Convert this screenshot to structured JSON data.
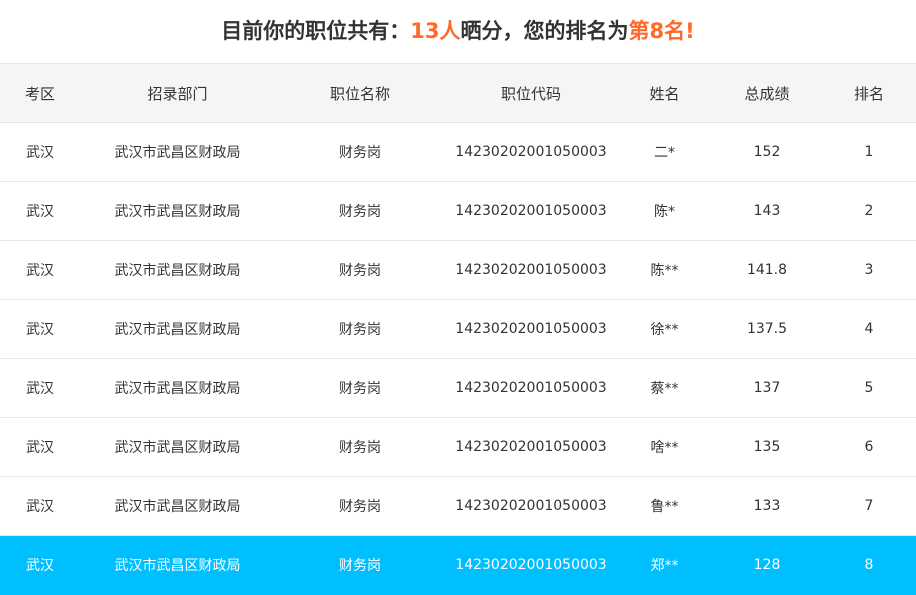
{
  "headline": {
    "prefix": "目前你的职位共有：",
    "count": "13人",
    "middle": "晒分，您的排名为",
    "rank": "第8名",
    "suffix": "!"
  },
  "table": {
    "headers": [
      "考区",
      "招录部门",
      "职位名称",
      "职位代码",
      "姓名",
      "总成绩",
      "排名"
    ],
    "rows": [
      [
        "武汉",
        "武汉市武昌区财政局",
        "财务岗",
        "14230202001050003",
        "二*",
        "152",
        "1"
      ],
      [
        "武汉",
        "武汉市武昌区财政局",
        "财务岗",
        "14230202001050003",
        "陈*",
        "143",
        "2"
      ],
      [
        "武汉",
        "武汉市武昌区财政局",
        "财务岗",
        "14230202001050003",
        "陈**",
        "141.8",
        "3"
      ],
      [
        "武汉",
        "武汉市武昌区财政局",
        "财务岗",
        "14230202001050003",
        "徐**",
        "137.5",
        "4"
      ],
      [
        "武汉",
        "武汉市武昌区财政局",
        "财务岗",
        "14230202001050003",
        "蔡**",
        "137",
        "5"
      ],
      [
        "武汉",
        "武汉市武昌区财政局",
        "财务岗",
        "14230202001050003",
        "啥**",
        "135",
        "6"
      ],
      [
        "武汉",
        "武汉市武昌区财政局",
        "财务岗",
        "14230202001050003",
        "鲁**",
        "133",
        "7"
      ],
      [
        "武汉",
        "武汉市武昌区财政局",
        "财务岗",
        "14230202001050003",
        "郑**",
        "128",
        "8"
      ]
    ],
    "highlight_row": 7
  },
  "colors": {
    "accent": "#ff6a2b",
    "highlight_row": "#00bfff",
    "header_bg": "#f5f5f5"
  }
}
